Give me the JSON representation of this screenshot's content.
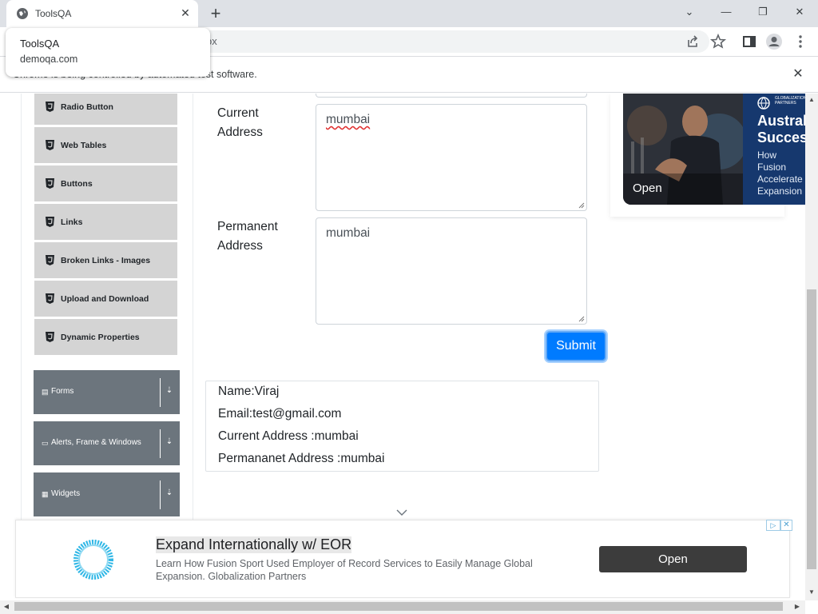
{
  "browser": {
    "tab_title": "ToolsQA",
    "close_tab": "✕",
    "new_tab": "+",
    "url_fragment": "ox",
    "infobar_message": "Chrome is being controlled by automated test software.",
    "infobar_close": "✕",
    "tooltip": {
      "title": "ToolsQA",
      "domain": "demoqa.com"
    },
    "window_controls": [
      "⌄",
      "—",
      "❐",
      "✕"
    ]
  },
  "sidebar": {
    "elements_items": [
      {
        "label": "Radio Button"
      },
      {
        "label": "Web Tables"
      },
      {
        "label": "Buttons"
      },
      {
        "label": "Links"
      },
      {
        "label": "Broken Links - Images"
      },
      {
        "label": "Upload and Download"
      },
      {
        "label": "Dynamic Properties"
      }
    ],
    "groups": [
      {
        "label": "Forms",
        "icon": "form-icon"
      },
      {
        "label": "Alerts, Frame & Windows",
        "icon": "window-icon"
      },
      {
        "label": "Widgets",
        "icon": "grid-icon"
      }
    ]
  },
  "form": {
    "current_address_label": "Current Address",
    "current_address_value": "mumbai",
    "permanent_address_label": "Permanent Address",
    "permanent_address_value": "mumbai",
    "submit_label": "Submit"
  },
  "output": {
    "name": "Name:Viraj",
    "email": "Email:test@gmail.com",
    "current_address": "Current Address :mumbai",
    "permanent_address": "Permananet Address :mumbai"
  },
  "side_ad": {
    "open_label": "Open",
    "brand": "GLOBALIZATION PARTNERS",
    "headline": "Austral Succes",
    "subtext": "How Fusion Accelerate Expansion Months to"
  },
  "bottom_ad": {
    "title": "Expand Internationally w/ EOR",
    "description": "Learn How Fusion Sport Used Employer of Record Services to Easily Manage Global Expansion. Globalization Partners",
    "open_label": "Open",
    "adchoices": "▷",
    "close": "✕"
  },
  "colors": {
    "primary": "#007bff",
    "group_bg": "#6c757d",
    "menu_bg": "#d4d4d4"
  }
}
